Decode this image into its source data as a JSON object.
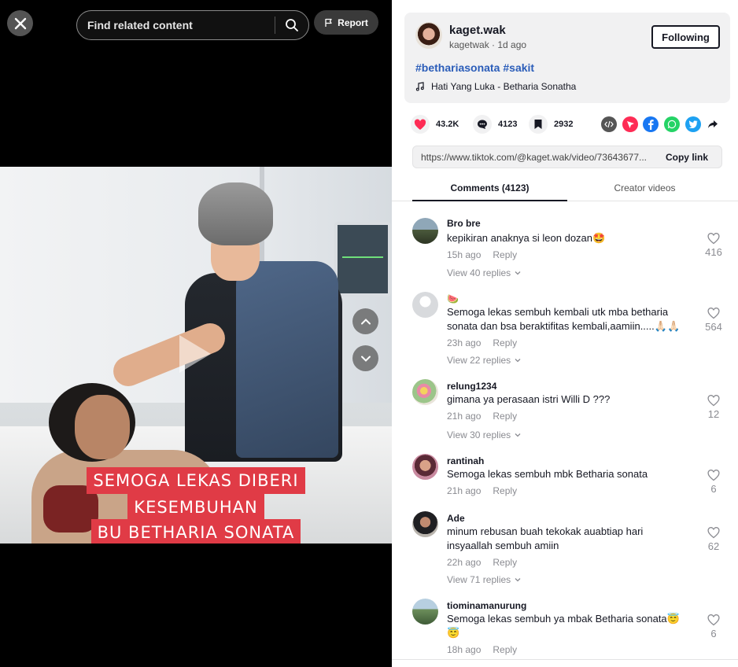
{
  "video": {
    "search_placeholder": "Find related content",
    "report_label": "Report",
    "caption_lines": [
      "SEMOGA LEKAS DIBERI",
      "KESEMBUHAN",
      "BU BETHARIA SONATA"
    ]
  },
  "author": {
    "name": "kaget.wak",
    "handle": "kagetwak",
    "time": "1d ago",
    "follow_label": "Following",
    "hashtags": [
      "#bethariasonata",
      "#sakit"
    ],
    "music": "Hati Yang Luka - Betharia Sonatha"
  },
  "stats": {
    "likes": "43.2K",
    "comments": "4123",
    "saves": "2932"
  },
  "share_icons": [
    "embed-icon",
    "send-icon",
    "facebook-icon",
    "whatsapp-icon",
    "twitter-icon",
    "share-arrow-icon"
  ],
  "link": {
    "url": "https://www.tiktok.com/@kaget.wak/video/73643677...",
    "copy_label": "Copy link"
  },
  "tabs": {
    "comments": "Comments (4123)",
    "creator": "Creator videos"
  },
  "colors": {
    "accent_red": "#fe2c55",
    "hashtag_blue": "#2b5db9",
    "caption_red": "#e03b46"
  },
  "comments": [
    {
      "user": "Bro bre",
      "text": "kepikiran anaknya si leon dozan🤩",
      "time": "15h ago",
      "reply": "Reply",
      "likes": "416",
      "more": "View 40 replies"
    },
    {
      "user": "🍉",
      "text": "Semoga lekas sembuh kembali utk mba betharia sonata dan bsa beraktifitas kembali,aamiin.....🙏🏻🙏🏻",
      "time": "23h ago",
      "reply": "Reply",
      "likes": "564",
      "more": "View 22 replies"
    },
    {
      "user": "relung1234",
      "text": "gimana ya perasaan istri Willi D ???",
      "time": "21h ago",
      "reply": "Reply",
      "likes": "12",
      "more": "View 30 replies"
    },
    {
      "user": "rantinah",
      "text": "Semoga lekas sembuh mbk Betharia sonata",
      "time": "21h ago",
      "reply": "Reply",
      "likes": "6",
      "more": ""
    },
    {
      "user": "Ade",
      "text": "minum rebusan buah tekokak auabtiap hari insyaallah sembuh amiin",
      "time": "22h ago",
      "reply": "Reply",
      "likes": "62",
      "more": "View 71 replies"
    },
    {
      "user": "tiominamanurung",
      "text": "Semoga lekas sembuh ya mbak Betharia sonata😇😇",
      "time": "18h ago",
      "reply": "Reply",
      "likes": "6",
      "more": ""
    }
  ]
}
